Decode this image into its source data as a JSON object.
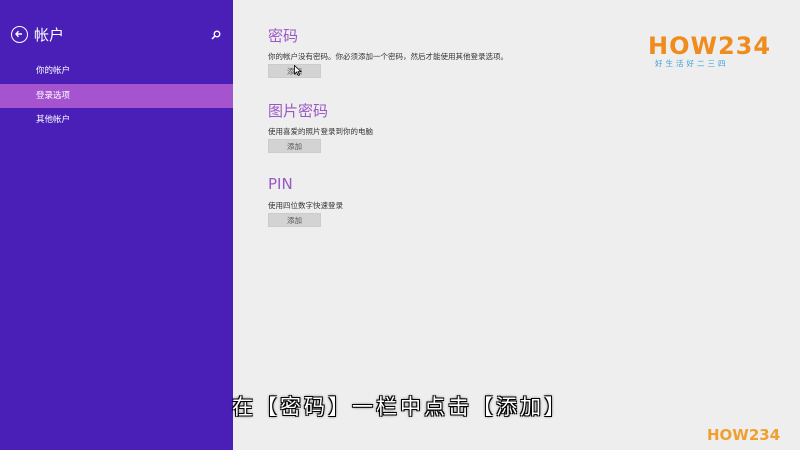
{
  "sidebar": {
    "title": "帐户",
    "items": [
      {
        "label": "你的帐户"
      },
      {
        "label": "登录选项"
      },
      {
        "label": "其他帐户"
      }
    ]
  },
  "main": {
    "sections": [
      {
        "title": "密码",
        "desc": "你的帐户没有密码。你必须添加一个密码，然后才能使用其他登录选项。",
        "button": "添加"
      },
      {
        "title": "图片密码",
        "desc": "使用喜爱的照片登录到你的电脑",
        "button": "添加"
      },
      {
        "title": "PIN",
        "desc": "使用四位数字快速登录",
        "button": "添加"
      }
    ]
  },
  "logo": {
    "text": "HOW234",
    "subtitle": "好生活好二三四"
  },
  "caption": "在【密码】一栏中点击【添加】",
  "watermark": "HOW234",
  "colors": {
    "sidebar": "#4a1fb8",
    "active_item": "#a553cf",
    "section_title": "#9a58c4"
  }
}
